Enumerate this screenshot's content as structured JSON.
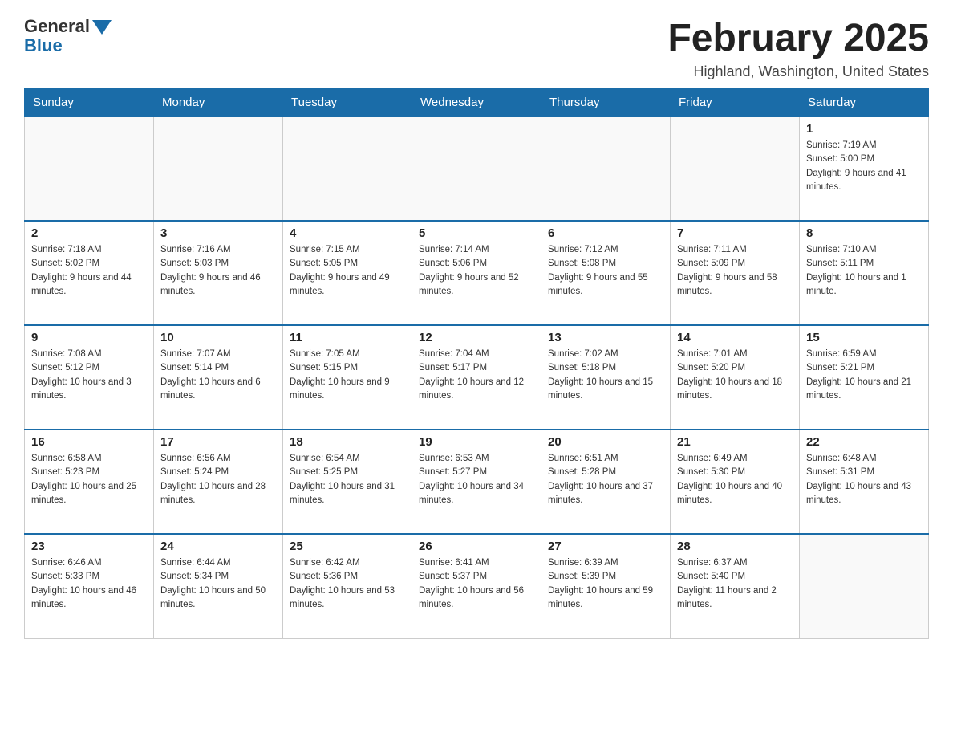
{
  "logo": {
    "general": "General",
    "blue": "Blue"
  },
  "title": "February 2025",
  "subtitle": "Highland, Washington, United States",
  "days_of_week": [
    "Sunday",
    "Monday",
    "Tuesday",
    "Wednesday",
    "Thursday",
    "Friday",
    "Saturday"
  ],
  "weeks": [
    [
      {
        "day": "",
        "sunrise": "",
        "sunset": "",
        "daylight": ""
      },
      {
        "day": "",
        "sunrise": "",
        "sunset": "",
        "daylight": ""
      },
      {
        "day": "",
        "sunrise": "",
        "sunset": "",
        "daylight": ""
      },
      {
        "day": "",
        "sunrise": "",
        "sunset": "",
        "daylight": ""
      },
      {
        "day": "",
        "sunrise": "",
        "sunset": "",
        "daylight": ""
      },
      {
        "day": "",
        "sunrise": "",
        "sunset": "",
        "daylight": ""
      },
      {
        "day": "1",
        "sunrise": "Sunrise: 7:19 AM",
        "sunset": "Sunset: 5:00 PM",
        "daylight": "Daylight: 9 hours and 41 minutes."
      }
    ],
    [
      {
        "day": "2",
        "sunrise": "Sunrise: 7:18 AM",
        "sunset": "Sunset: 5:02 PM",
        "daylight": "Daylight: 9 hours and 44 minutes."
      },
      {
        "day": "3",
        "sunrise": "Sunrise: 7:16 AM",
        "sunset": "Sunset: 5:03 PM",
        "daylight": "Daylight: 9 hours and 46 minutes."
      },
      {
        "day": "4",
        "sunrise": "Sunrise: 7:15 AM",
        "sunset": "Sunset: 5:05 PM",
        "daylight": "Daylight: 9 hours and 49 minutes."
      },
      {
        "day": "5",
        "sunrise": "Sunrise: 7:14 AM",
        "sunset": "Sunset: 5:06 PM",
        "daylight": "Daylight: 9 hours and 52 minutes."
      },
      {
        "day": "6",
        "sunrise": "Sunrise: 7:12 AM",
        "sunset": "Sunset: 5:08 PM",
        "daylight": "Daylight: 9 hours and 55 minutes."
      },
      {
        "day": "7",
        "sunrise": "Sunrise: 7:11 AM",
        "sunset": "Sunset: 5:09 PM",
        "daylight": "Daylight: 9 hours and 58 minutes."
      },
      {
        "day": "8",
        "sunrise": "Sunrise: 7:10 AM",
        "sunset": "Sunset: 5:11 PM",
        "daylight": "Daylight: 10 hours and 1 minute."
      }
    ],
    [
      {
        "day": "9",
        "sunrise": "Sunrise: 7:08 AM",
        "sunset": "Sunset: 5:12 PM",
        "daylight": "Daylight: 10 hours and 3 minutes."
      },
      {
        "day": "10",
        "sunrise": "Sunrise: 7:07 AM",
        "sunset": "Sunset: 5:14 PM",
        "daylight": "Daylight: 10 hours and 6 minutes."
      },
      {
        "day": "11",
        "sunrise": "Sunrise: 7:05 AM",
        "sunset": "Sunset: 5:15 PM",
        "daylight": "Daylight: 10 hours and 9 minutes."
      },
      {
        "day": "12",
        "sunrise": "Sunrise: 7:04 AM",
        "sunset": "Sunset: 5:17 PM",
        "daylight": "Daylight: 10 hours and 12 minutes."
      },
      {
        "day": "13",
        "sunrise": "Sunrise: 7:02 AM",
        "sunset": "Sunset: 5:18 PM",
        "daylight": "Daylight: 10 hours and 15 minutes."
      },
      {
        "day": "14",
        "sunrise": "Sunrise: 7:01 AM",
        "sunset": "Sunset: 5:20 PM",
        "daylight": "Daylight: 10 hours and 18 minutes."
      },
      {
        "day": "15",
        "sunrise": "Sunrise: 6:59 AM",
        "sunset": "Sunset: 5:21 PM",
        "daylight": "Daylight: 10 hours and 21 minutes."
      }
    ],
    [
      {
        "day": "16",
        "sunrise": "Sunrise: 6:58 AM",
        "sunset": "Sunset: 5:23 PM",
        "daylight": "Daylight: 10 hours and 25 minutes."
      },
      {
        "day": "17",
        "sunrise": "Sunrise: 6:56 AM",
        "sunset": "Sunset: 5:24 PM",
        "daylight": "Daylight: 10 hours and 28 minutes."
      },
      {
        "day": "18",
        "sunrise": "Sunrise: 6:54 AM",
        "sunset": "Sunset: 5:25 PM",
        "daylight": "Daylight: 10 hours and 31 minutes."
      },
      {
        "day": "19",
        "sunrise": "Sunrise: 6:53 AM",
        "sunset": "Sunset: 5:27 PM",
        "daylight": "Daylight: 10 hours and 34 minutes."
      },
      {
        "day": "20",
        "sunrise": "Sunrise: 6:51 AM",
        "sunset": "Sunset: 5:28 PM",
        "daylight": "Daylight: 10 hours and 37 minutes."
      },
      {
        "day": "21",
        "sunrise": "Sunrise: 6:49 AM",
        "sunset": "Sunset: 5:30 PM",
        "daylight": "Daylight: 10 hours and 40 minutes."
      },
      {
        "day": "22",
        "sunrise": "Sunrise: 6:48 AM",
        "sunset": "Sunset: 5:31 PM",
        "daylight": "Daylight: 10 hours and 43 minutes."
      }
    ],
    [
      {
        "day": "23",
        "sunrise": "Sunrise: 6:46 AM",
        "sunset": "Sunset: 5:33 PM",
        "daylight": "Daylight: 10 hours and 46 minutes."
      },
      {
        "day": "24",
        "sunrise": "Sunrise: 6:44 AM",
        "sunset": "Sunset: 5:34 PM",
        "daylight": "Daylight: 10 hours and 50 minutes."
      },
      {
        "day": "25",
        "sunrise": "Sunrise: 6:42 AM",
        "sunset": "Sunset: 5:36 PM",
        "daylight": "Daylight: 10 hours and 53 minutes."
      },
      {
        "day": "26",
        "sunrise": "Sunrise: 6:41 AM",
        "sunset": "Sunset: 5:37 PM",
        "daylight": "Daylight: 10 hours and 56 minutes."
      },
      {
        "day": "27",
        "sunrise": "Sunrise: 6:39 AM",
        "sunset": "Sunset: 5:39 PM",
        "daylight": "Daylight: 10 hours and 59 minutes."
      },
      {
        "day": "28",
        "sunrise": "Sunrise: 6:37 AM",
        "sunset": "Sunset: 5:40 PM",
        "daylight": "Daylight: 11 hours and 2 minutes."
      },
      {
        "day": "",
        "sunrise": "",
        "sunset": "",
        "daylight": ""
      }
    ]
  ]
}
